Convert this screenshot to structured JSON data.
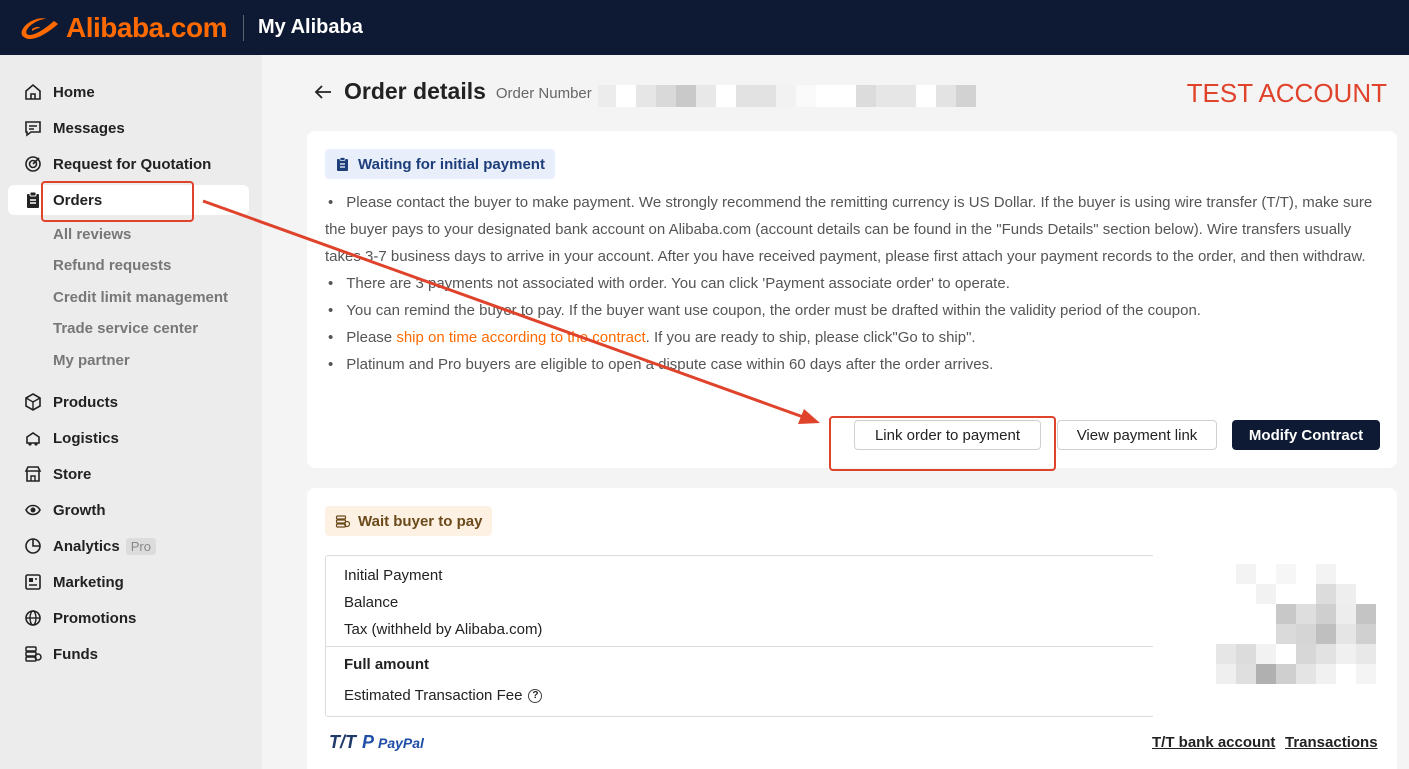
{
  "header": {
    "brand": "Alibaba.com",
    "title": "My Alibaba"
  },
  "sidebar": {
    "items": [
      {
        "label": "Home",
        "icon": "home-icon"
      },
      {
        "label": "Messages",
        "icon": "message-icon"
      },
      {
        "label": "Request for Quotation",
        "icon": "target-icon"
      },
      {
        "label": "Orders",
        "icon": "clipboard-icon",
        "active": true
      },
      {
        "label": "Products",
        "icon": "box-icon"
      },
      {
        "label": "Logistics",
        "icon": "truck-icon"
      },
      {
        "label": "Store",
        "icon": "store-icon"
      },
      {
        "label": "Growth",
        "icon": "growth-icon"
      },
      {
        "label": "Analytics",
        "icon": "analytics-icon",
        "badge": "Pro"
      },
      {
        "label": "Marketing",
        "icon": "marketing-icon"
      },
      {
        "label": "Promotions",
        "icon": "globe-icon"
      },
      {
        "label": "Funds",
        "icon": "funds-icon"
      }
    ],
    "sub_items": [
      "All reviews",
      "Refund requests",
      "Credit limit management",
      "Trade service center",
      "My partner"
    ]
  },
  "page": {
    "title": "Order details",
    "order_number_label": "Order Number",
    "watermark": "TEST ACCOUNT"
  },
  "payment_card": {
    "status": "Waiting for initial payment",
    "notes": {
      "n1": "Please contact the buyer to make payment. We strongly recommend the remitting currency is US Dollar. If the buyer is using wire transfer (T/T), make sure the buyer pays to your designated bank account on Alibaba.com (account details can be found in the \"Funds Details\" section below). Wire transfers usually takes 3-7 business days to arrive in your account. After you have received payment, please first attach your payment records to the order, and then withdraw.",
      "n2": "There are 3 payments not associated with order. You can click 'Payment associate order' to operate.",
      "n3": "You can remind the buyer to pay. If the buyer want use coupon, the order must be drafted within the validity period of the coupon.",
      "n4_prefix": "Please ",
      "n4_link": "ship on time according to the contract",
      "n4_suffix": ". If you are ready to ship, please click\"Go to ship\".",
      "n5": "Platinum and Pro buyers are eligible to open a dispute case within 60 days after the order arrives."
    },
    "buttons": {
      "link_order": "Link order to payment",
      "view_link": "View payment link",
      "modify": "Modify Contract"
    }
  },
  "amount_card": {
    "status": "Wait buyer to pay",
    "rows": {
      "initial": "Initial Payment",
      "balance": "Balance",
      "tax": "Tax (withheld by Alibaba.com)",
      "full": "Full amount",
      "fee": "Estimated Transaction Fee"
    },
    "help_glyph": "?",
    "methods": {
      "tt": "T/T",
      "paypal_mark": "P",
      "paypal": "PayPal"
    },
    "links": {
      "bank": "T/T bank account",
      "transactions": "Transactions"
    }
  },
  "colors": {
    "brand_orange": "#ff6a00",
    "header_bg": "#0e1a33",
    "annotation_red": "#e0432b"
  }
}
